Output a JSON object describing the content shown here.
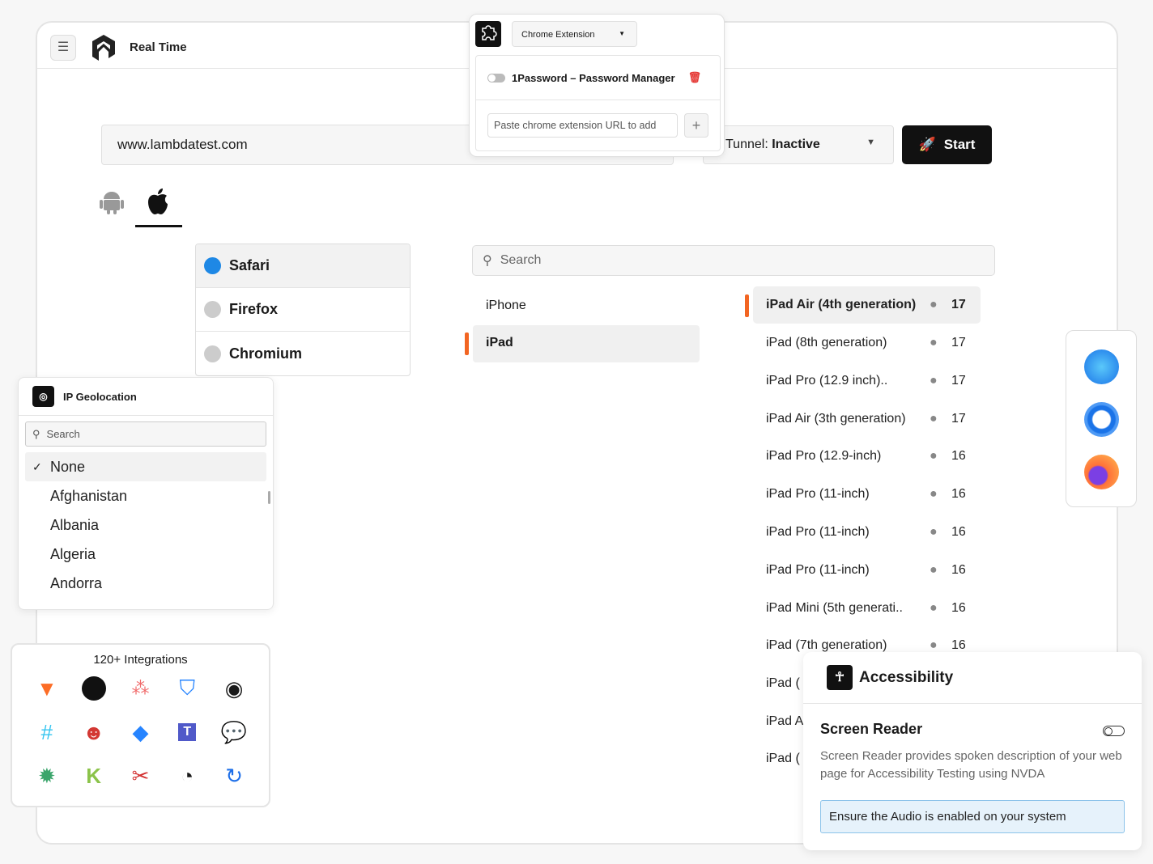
{
  "header": {
    "title": "Real Time"
  },
  "url_input": {
    "value": "www.lambdatest.com"
  },
  "tunnel": {
    "label": "Tunnel: ",
    "value": "Inactive"
  },
  "start_label": "Start",
  "browsers": [
    {
      "name": "Safari",
      "color": "#1e88e5"
    },
    {
      "name": "Firefox",
      "color": "#c8c8c8"
    },
    {
      "name": "Chromium",
      "color": "#c8c8c8"
    }
  ],
  "device_search": {
    "placeholder": "Search"
  },
  "device_types": [
    "iPhone",
    "iPad"
  ],
  "devices": [
    {
      "name": "iPad Air (4th generation)",
      "version": "17"
    },
    {
      "name": "iPad (8th generation)",
      "version": "17"
    },
    {
      "name": "iPad Pro (12.9 inch)..",
      "version": "17"
    },
    {
      "name": "iPad Air (3th generation)",
      "version": "17"
    },
    {
      "name": "iPad Pro (12.9-inch)",
      "version": "16"
    },
    {
      "name": "iPad Pro (11-inch)",
      "version": "16"
    },
    {
      "name": "iPad Pro (11-inch)",
      "version": "16"
    },
    {
      "name": "iPad Pro (11-inch)",
      "version": "16"
    },
    {
      "name": "iPad Mini (5th generati..",
      "version": "16"
    },
    {
      "name": "iPad (7th generation)",
      "version": "16"
    },
    {
      "name": "iPad (",
      "version": ""
    },
    {
      "name": "iPad A",
      "version": ""
    },
    {
      "name": "iPad (",
      "version": ""
    }
  ],
  "extension": {
    "dropdown": "Chrome Extension",
    "item": "1Password – Password Manager",
    "url_placeholder": "Paste chrome extension URL to add"
  },
  "geolocation": {
    "title": "IP Geolocation",
    "search_placeholder": "Search",
    "items": [
      "None",
      "Afghanistan",
      "Albania",
      "Algeria",
      "Andorra"
    ]
  },
  "integrations": {
    "title": "120+ Integrations"
  },
  "accessibility": {
    "title": "Accessibility",
    "screen_reader": "Screen Reader",
    "description": "Screen Reader provides spoken description of your web page for Accessibility Testing using NVDA",
    "note": "Ensure the Audio is enabled on your system"
  }
}
